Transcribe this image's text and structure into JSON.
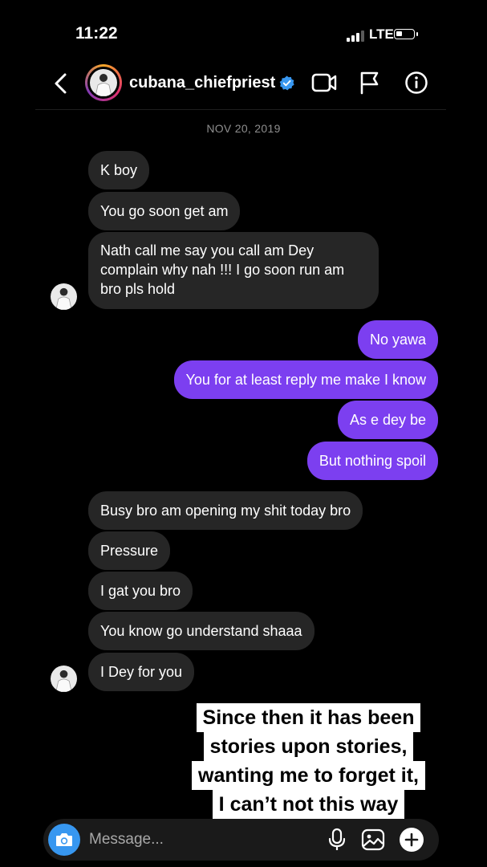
{
  "status_bar": {
    "time": "11:22",
    "network": "LTE"
  },
  "header": {
    "username": "cubana_chiefpriest"
  },
  "date_separator": "NOV 20, 2019",
  "messages": [
    {
      "from": "them",
      "text": "K boy"
    },
    {
      "from": "them",
      "text": "You go soon get am"
    },
    {
      "from": "them",
      "text": "Nath call me say you call am Dey complain why nah !!! I go soon run am bro pls hold"
    },
    {
      "from": "me",
      "text": "No yawa"
    },
    {
      "from": "me",
      "text": "You for at least reply me make I know"
    },
    {
      "from": "me",
      "text": "As e dey be"
    },
    {
      "from": "me",
      "text": "But nothing spoil"
    },
    {
      "from": "them",
      "text": "Busy bro am opening my shit today bro"
    },
    {
      "from": "them",
      "text": "Pressure"
    },
    {
      "from": "them",
      "text": "I gat you bro"
    },
    {
      "from": "them",
      "text": "You know go understand shaaa"
    },
    {
      "from": "them",
      "text": "I Dey for you"
    }
  ],
  "overlay_caption": [
    "Since then it has been",
    "stories upon stories,",
    "wanting me to forget it,",
    "I can’t not this way"
  ],
  "composer": {
    "placeholder": "Message..."
  },
  "colors": {
    "sent_bubble": "#7c3ff0",
    "received_bubble": "#262626",
    "camera_button": "#3797f0",
    "verified_badge": "#3897f0"
  },
  "icons": [
    "back-icon",
    "verified-badge-icon",
    "video-call-icon",
    "flag-icon",
    "info-icon",
    "camera-icon",
    "microphone-icon",
    "gallery-icon",
    "plus-icon"
  ]
}
